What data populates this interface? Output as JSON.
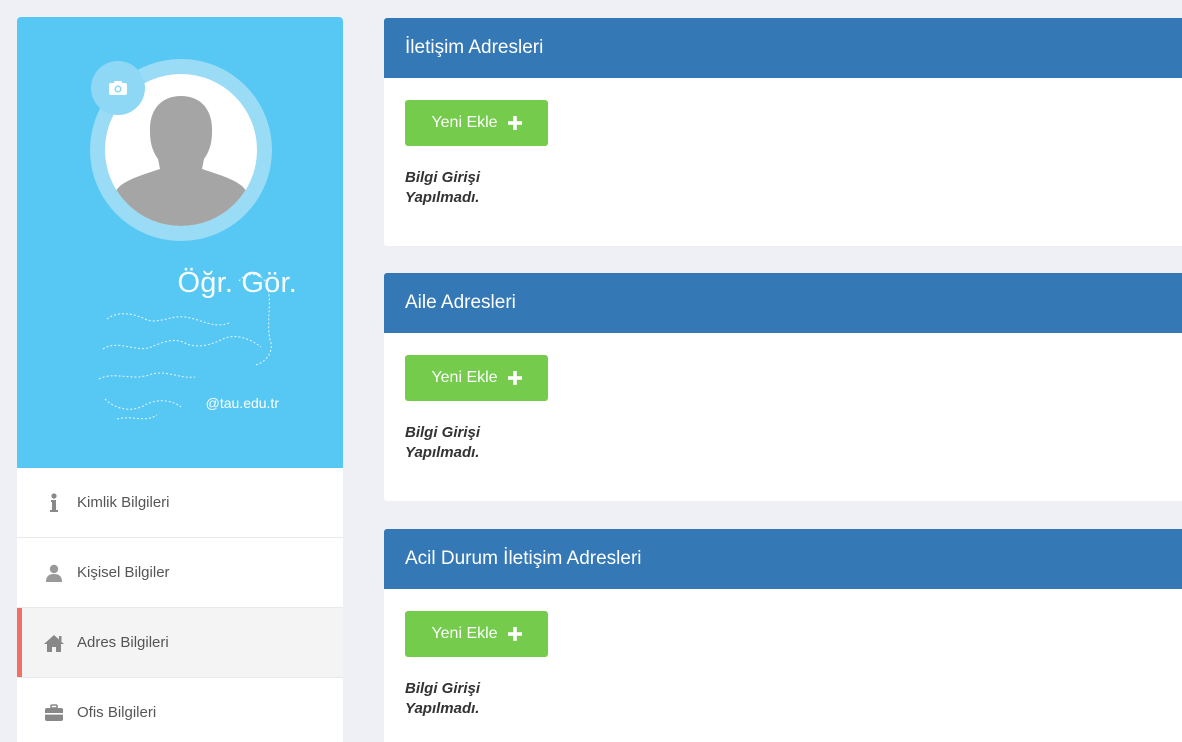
{
  "profile": {
    "title": "Öğr. Gör.",
    "email": "@tau.edu.tr"
  },
  "menu": {
    "items": [
      {
        "label": "Kimlik Bilgileri",
        "icon": "info-icon"
      },
      {
        "label": "Kişisel Bilgiler",
        "icon": "user-icon"
      },
      {
        "label": "Adres Bilgileri",
        "icon": "home-icon",
        "active": true
      },
      {
        "label": "Ofis Bilgileri",
        "icon": "briefcase-icon"
      }
    ]
  },
  "panels": [
    {
      "title": "İletişim Adresleri",
      "button_label": "Yeni Ekle",
      "empty_text": "Bilgi Girişi Yapılmadı."
    },
    {
      "title": "Aile Adresleri",
      "button_label": "Yeni Ekle",
      "empty_text": "Bilgi Girişi Yapılmadı."
    },
    {
      "title": "Acil Durum İletişim Adresleri",
      "button_label": "Yeni Ekle",
      "empty_text": "Bilgi Girişi Yapılmadı."
    }
  ],
  "colors": {
    "profile_bg": "#57c7f3",
    "panel_header": "#3478b6",
    "add_button": "#74cb4c",
    "active_marker": "#f07065",
    "page_bg": "#eef0f5"
  }
}
